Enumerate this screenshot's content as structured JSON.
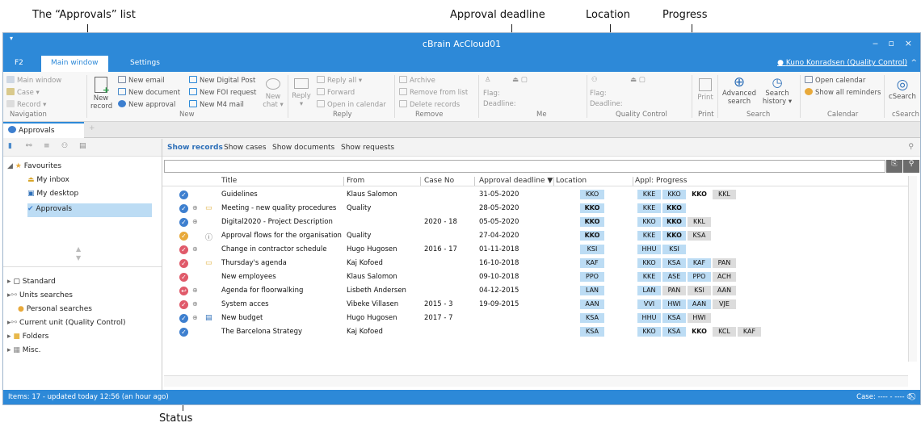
{
  "annotations": {
    "approvals_list": "The “Approvals” list",
    "approval_deadline": "Approval deadline",
    "location": "Location",
    "progress": "Progress",
    "status": "Status"
  },
  "window": {
    "title": "cBrain AcCloud01",
    "minimize": "‒",
    "maximize": "▫",
    "close": "×"
  },
  "tabs": {
    "f2": "F2",
    "main": "Main window",
    "settings": "Settings"
  },
  "user": "Kuno Konradsen (Quality Control)",
  "ribbon": {
    "nav": {
      "main_window": "Main window",
      "case": "Case ▾",
      "record": "Record ▾",
      "group": "Navigation"
    },
    "new": {
      "new_record_1": "New",
      "new_record_2": "record",
      "new_email": "New email",
      "new_document": "New document",
      "new_approval": "New approval",
      "new_digital_post": "New Digital Post",
      "new_foi_request": "New FOI request",
      "new_m4_mail": "New M4 mail",
      "new_chat_1": "New",
      "new_chat_2": "chat ▾",
      "group": "New"
    },
    "reply": {
      "reply_1": "Reply",
      "reply_2": "▾",
      "reply_all": "Reply all ▾",
      "forward": "Forward",
      "open_in_calendar": "Open in calendar",
      "group": "Reply"
    },
    "remove": {
      "archive": "Archive",
      "remove_from_list": "Remove from list",
      "delete_records": "Delete records",
      "group": "Remove"
    },
    "me": {
      "flag": "Flag:",
      "deadline": "Deadline:",
      "group": "Me"
    },
    "qc": {
      "flag": "Flag:",
      "deadline": "Deadline:",
      "group": "Quality Control"
    },
    "print": {
      "label": "Print",
      "group": "Print"
    },
    "search": {
      "advanced_1": "Advanced",
      "advanced_2": "search",
      "history_1": "Search",
      "history_2": "history ▾",
      "group": "Search"
    },
    "calendar": {
      "open_calendar": "Open calendar",
      "show_all_reminders": "Show all reminders",
      "group": "Calendar"
    },
    "csearch": {
      "label": "cSearch",
      "group": "cSearch"
    }
  },
  "doc_tab": "Approvals",
  "tree": {
    "favourites": "Favourites",
    "my_inbox": "My inbox",
    "my_desktop": "My desktop",
    "approvals": "Approvals",
    "standard": "Standard",
    "units_searches": "Units searches",
    "personal_searches": "Personal searches",
    "current_unit": "Current unit (Quality Control)",
    "folders": "Folders",
    "misc": "Misc."
  },
  "filters": {
    "records": "Show records",
    "cases": "Show cases",
    "documents": "Show documents",
    "requests": "Show requests"
  },
  "columns": {
    "title": "Title",
    "from": "From",
    "case_no": "Case No",
    "deadline": "Approval deadline ▼",
    "location": "Location",
    "progress": "Appl: Progress"
  },
  "rows": [
    {
      "status": "done",
      "clip": "",
      "icon": "",
      "title": "Guidelines",
      "from": "Klaus Salomon",
      "case": "",
      "deadline": "31-05-2020",
      "loc": "KKO",
      "loc_bold": false,
      "progress": [
        {
          "t": "KKE",
          "c": "b"
        },
        {
          "t": "KKO",
          "c": "b"
        },
        {
          "t": "KKO",
          "c": "w",
          "b": true
        },
        {
          "t": "KKL",
          "c": "g"
        }
      ]
    },
    {
      "status": "done",
      "clip": "⊕",
      "icon": "folder",
      "title": "Meeting - new quality procedures",
      "from": "Quality",
      "case": "",
      "deadline": "28-05-2020",
      "loc": "KKO",
      "loc_bold": true,
      "progress": [
        {
          "t": "KKE",
          "c": "b"
        },
        {
          "t": "KKO",
          "c": "b",
          "b": true
        }
      ]
    },
    {
      "status": "done",
      "clip": "⊕",
      "icon": "",
      "title": "Digital2020 - Project Description",
      "from": "",
      "case": "2020 - 18",
      "deadline": "05-05-2020",
      "loc": "KKO",
      "loc_bold": true,
      "progress": [
        {
          "t": "KKO",
          "c": "b"
        },
        {
          "t": "KKO",
          "c": "b",
          "b": true
        },
        {
          "t": "KKL",
          "c": "g"
        }
      ]
    },
    {
      "status": "pending",
      "clip": "",
      "icon": "info",
      "title": "Approval flows for the organisation",
      "from": "Quality",
      "case": "",
      "deadline": "27-04-2020",
      "loc": "KKO",
      "loc_bold": true,
      "progress": [
        {
          "t": "KKE",
          "c": "b"
        },
        {
          "t": "KKO",
          "c": "b",
          "b": true
        },
        {
          "t": "KSA",
          "c": "g"
        }
      ]
    },
    {
      "status": "rejected",
      "clip": "⊕",
      "icon": "",
      "title": "Change in contractor schedule",
      "from": "Hugo Hugosen",
      "case": "2016 - 17",
      "deadline": "01-11-2018",
      "loc": "KSI",
      "loc_bold": false,
      "progress": [
        {
          "t": "HHU",
          "c": "b"
        },
        {
          "t": "KSI",
          "c": "b"
        }
      ]
    },
    {
      "status": "rejected",
      "clip": "",
      "icon": "folder",
      "title": "Thursday's agenda",
      "from": "Kaj Kofoed",
      "case": "",
      "deadline": "16-10-2018",
      "loc": "KAF",
      "loc_bold": false,
      "progress": [
        {
          "t": "KKO",
          "c": "b"
        },
        {
          "t": "KSA",
          "c": "b"
        },
        {
          "t": "KAF",
          "c": "b"
        },
        {
          "t": "PAN",
          "c": "g"
        }
      ]
    },
    {
      "status": "rejected",
      "clip": "",
      "icon": "",
      "title": "New employees",
      "from": "Klaus Salomon",
      "case": "",
      "deadline": "09-10-2018",
      "loc": "PPO",
      "loc_bold": false,
      "progress": [
        {
          "t": "KKE",
          "c": "b"
        },
        {
          "t": "ASE",
          "c": "b"
        },
        {
          "t": "PPO",
          "c": "b"
        },
        {
          "t": "ACH",
          "c": "g"
        }
      ]
    },
    {
      "status": "returned",
      "clip": "⊕",
      "icon": "",
      "title": "Agenda for floorwalking",
      "from": "Lisbeth Andersen",
      "case": "",
      "deadline": "04-12-2015",
      "loc": "LAN",
      "loc_bold": false,
      "progress": [
        {
          "t": "LAN",
          "c": "b"
        },
        {
          "t": "PAN",
          "c": "g"
        },
        {
          "t": "KSI",
          "c": "g"
        },
        {
          "t": "AAN",
          "c": "g"
        }
      ]
    },
    {
      "status": "rejected",
      "clip": "⊕",
      "icon": "",
      "title": "System acces",
      "from": "Vibeke Villasen",
      "case": "2015 - 3",
      "deadline": "19-09-2015",
      "loc": "AAN",
      "loc_bold": false,
      "progress": [
        {
          "t": "VVI",
          "c": "b"
        },
        {
          "t": "HWI",
          "c": "b"
        },
        {
          "t": "AAN",
          "c": "b"
        },
        {
          "t": "VJE",
          "c": "g"
        }
      ]
    },
    {
      "status": "done",
      "clip": "⊕",
      "icon": "doc",
      "title": "New budget",
      "from": "Hugo Hugosen",
      "case": "2017 - 7",
      "deadline": "",
      "loc": "KSA",
      "loc_bold": false,
      "progress": [
        {
          "t": "HHU",
          "c": "b"
        },
        {
          "t": "KSA",
          "c": "b"
        },
        {
          "t": "HWI",
          "c": "g"
        }
      ]
    },
    {
      "status": "done",
      "clip": "",
      "icon": "",
      "title": "The Barcelona Strategy",
      "from": "Kaj Kofoed",
      "case": "",
      "deadline": "",
      "loc": "KSA",
      "loc_bold": false,
      "progress": [
        {
          "t": "KKO",
          "c": "b"
        },
        {
          "t": "KSA",
          "c": "b"
        },
        {
          "t": "KKO",
          "c": "w",
          "b": true
        },
        {
          "t": "KCL",
          "c": "g"
        },
        {
          "t": "KAF",
          "c": "g"
        }
      ]
    }
  ],
  "status_colors": {
    "done": "#3d7fcf",
    "pending": "#e8a93a",
    "rejected": "#e05a6a",
    "returned": "#e05a6a"
  },
  "status_glyphs": {
    "done": "✓",
    "pending": "✓",
    "rejected": "✓",
    "returned": "↩"
  },
  "statusbar": {
    "left": "Items: 17 - updated today 12:56 (an hour ago)",
    "right": "Case: ---- - ---- ⏱ ⃠"
  }
}
